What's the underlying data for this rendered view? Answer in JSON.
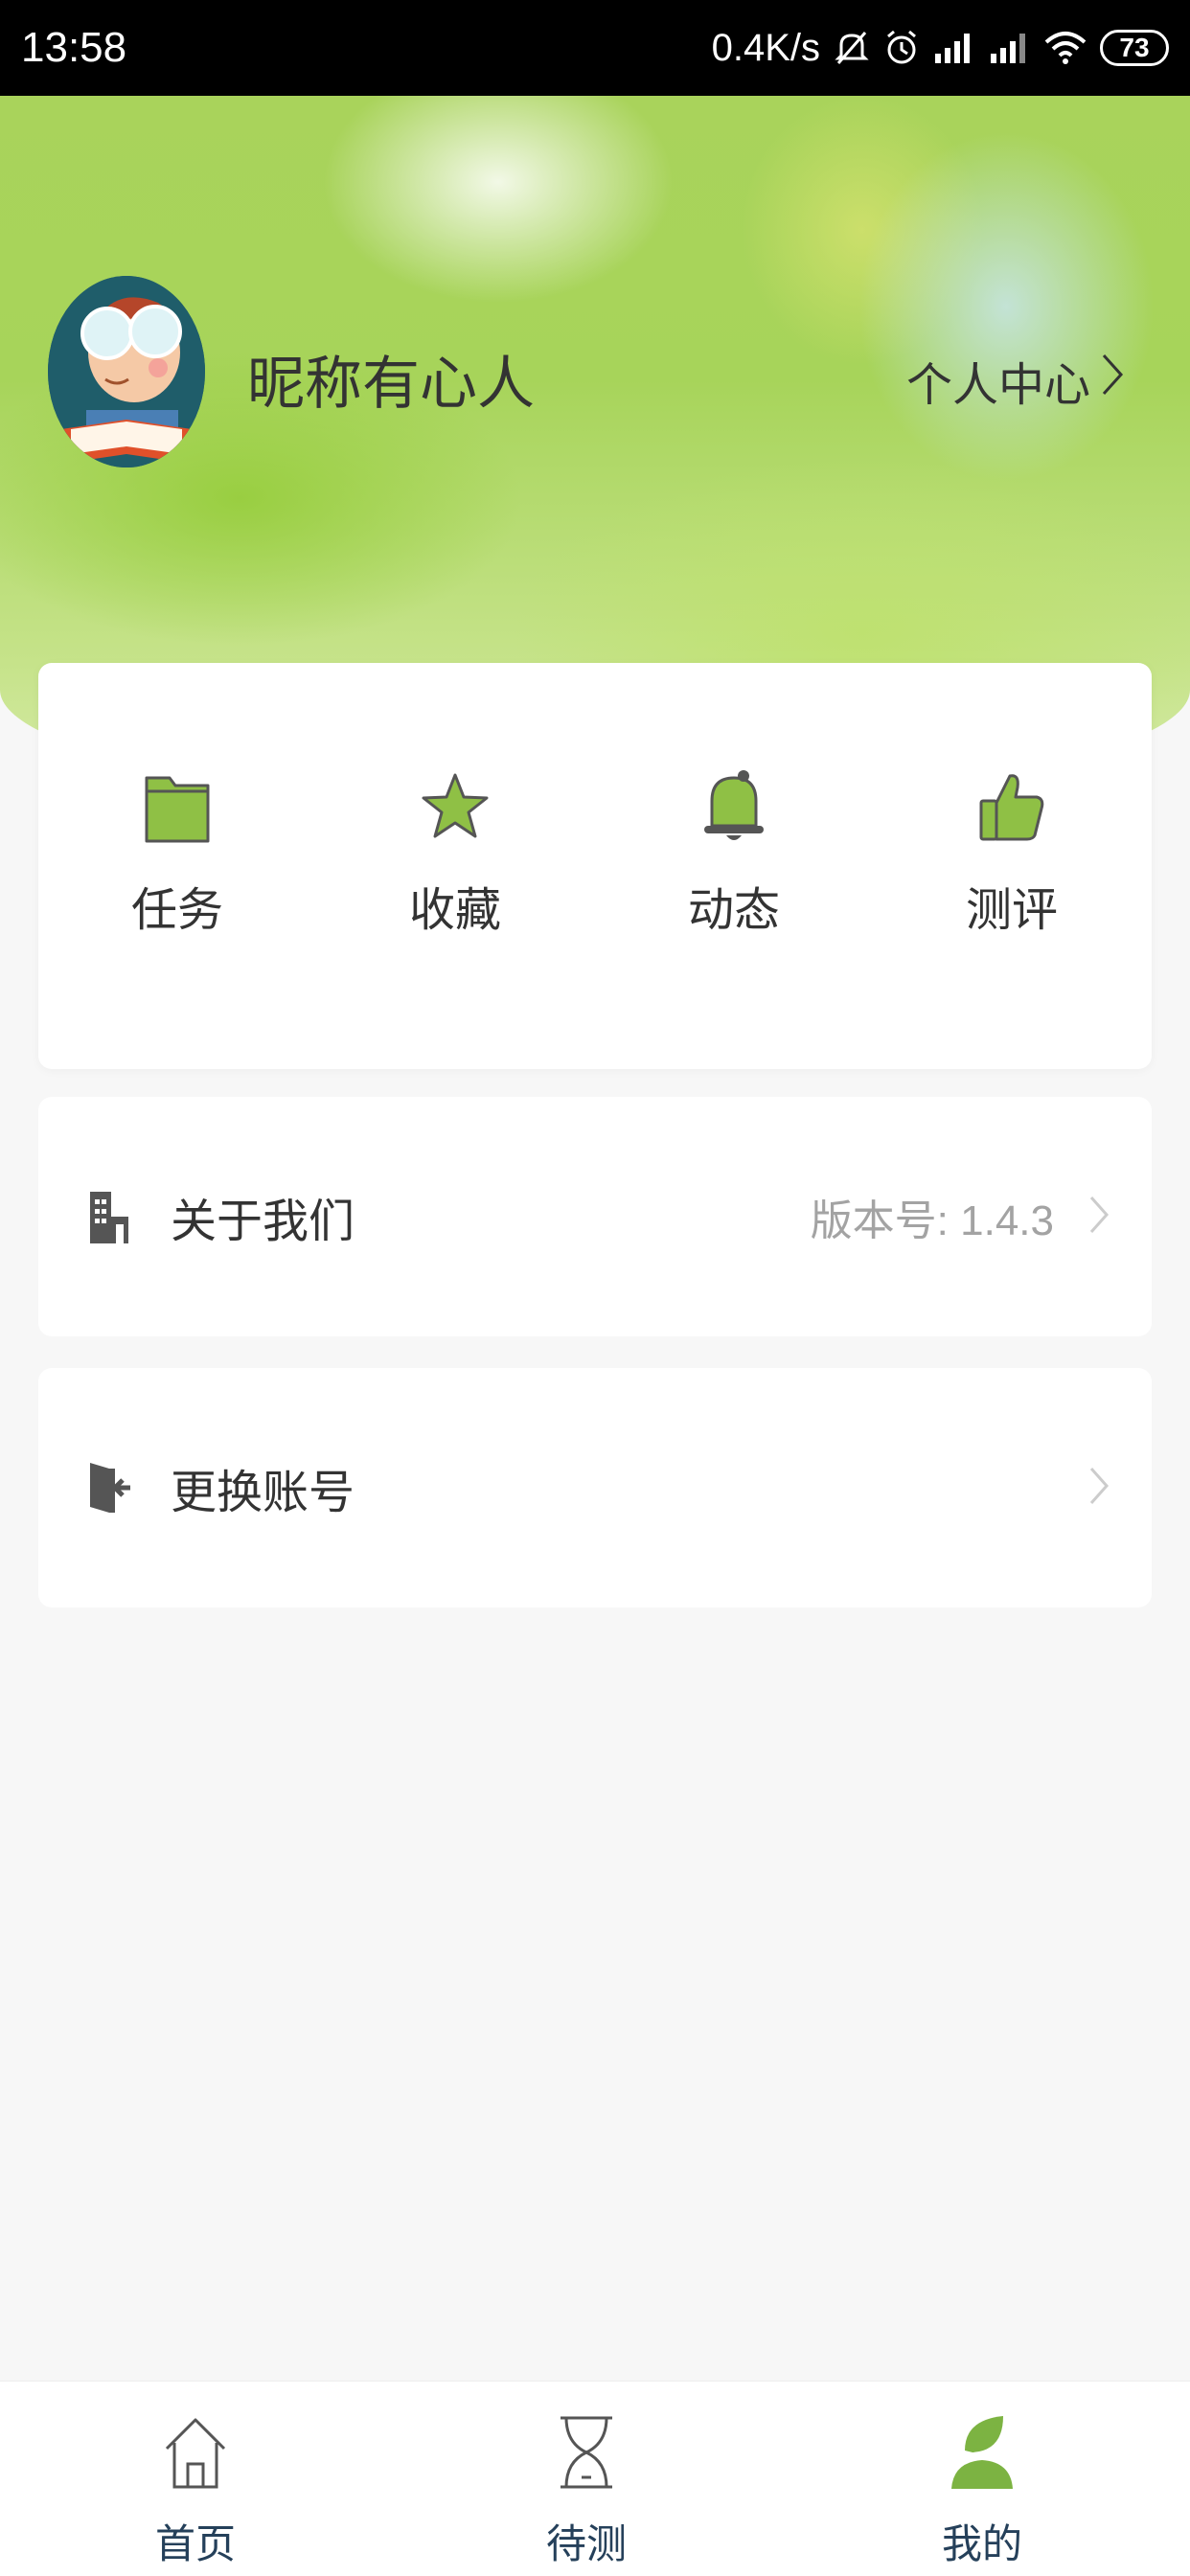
{
  "status_bar": {
    "time": "13:58",
    "net_speed": "0.4K/s",
    "battery": "73"
  },
  "profile": {
    "nickname": "昵称有心人",
    "center_link": "个人中心",
    "avatar_icon": "boy-reading-avatar"
  },
  "quick_actions": [
    {
      "label": "任务",
      "icon": "folder-icon"
    },
    {
      "label": "收藏",
      "icon": "star-icon"
    },
    {
      "label": "动态",
      "icon": "bell-icon"
    },
    {
      "label": "测评",
      "icon": "thumbs-up-icon"
    }
  ],
  "menu": {
    "about": {
      "label": "关于我们",
      "value": "版本号: 1.4.3",
      "icon": "building-icon"
    },
    "switch_account": {
      "label": "更换账号",
      "icon": "exit-door-icon"
    }
  },
  "tabbar": {
    "items": [
      {
        "label": "首页",
        "icon": "home-icon",
        "active": false
      },
      {
        "label": "待测",
        "icon": "hourglass-icon",
        "active": false
      },
      {
        "label": "我的",
        "icon": "user-icon",
        "active": true
      }
    ]
  },
  "colors": {
    "accent_green": "#7cb342",
    "tab_text": "#25405a",
    "icon_gray": "#555555"
  }
}
